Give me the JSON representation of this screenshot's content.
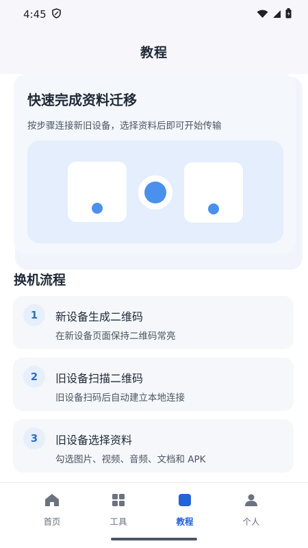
{
  "status_bar": {
    "time": "4:45"
  },
  "header": {
    "title": "教程"
  },
  "hero": {
    "title": "快速完成资料迁移",
    "subtitle": "按步骤连接新旧设备，选择资料后即可开始传输"
  },
  "section": {
    "title": "换机流程"
  },
  "steps": [
    {
      "number": "1",
      "title": "新设备生成二维码",
      "desc": "在新设备页面保持二维码常亮"
    },
    {
      "number": "2",
      "title": "旧设备扫描二维码",
      "desc": "旧设备扫码后自动建立本地连接"
    },
    {
      "number": "3",
      "title": "旧设备选择资料",
      "desc": "勾选图片、视频、音频、文档和 APK"
    }
  ],
  "nav": {
    "items": [
      {
        "label": "首页",
        "icon": "home-icon"
      },
      {
        "label": "工具",
        "icon": "grid-icon"
      },
      {
        "label": "教程",
        "icon": "tutorial-icon",
        "active": true
      },
      {
        "label": "个人",
        "icon": "person-icon"
      }
    ]
  },
  "colors": {
    "accent": "#2563d9",
    "dot": "#4a90ec"
  }
}
